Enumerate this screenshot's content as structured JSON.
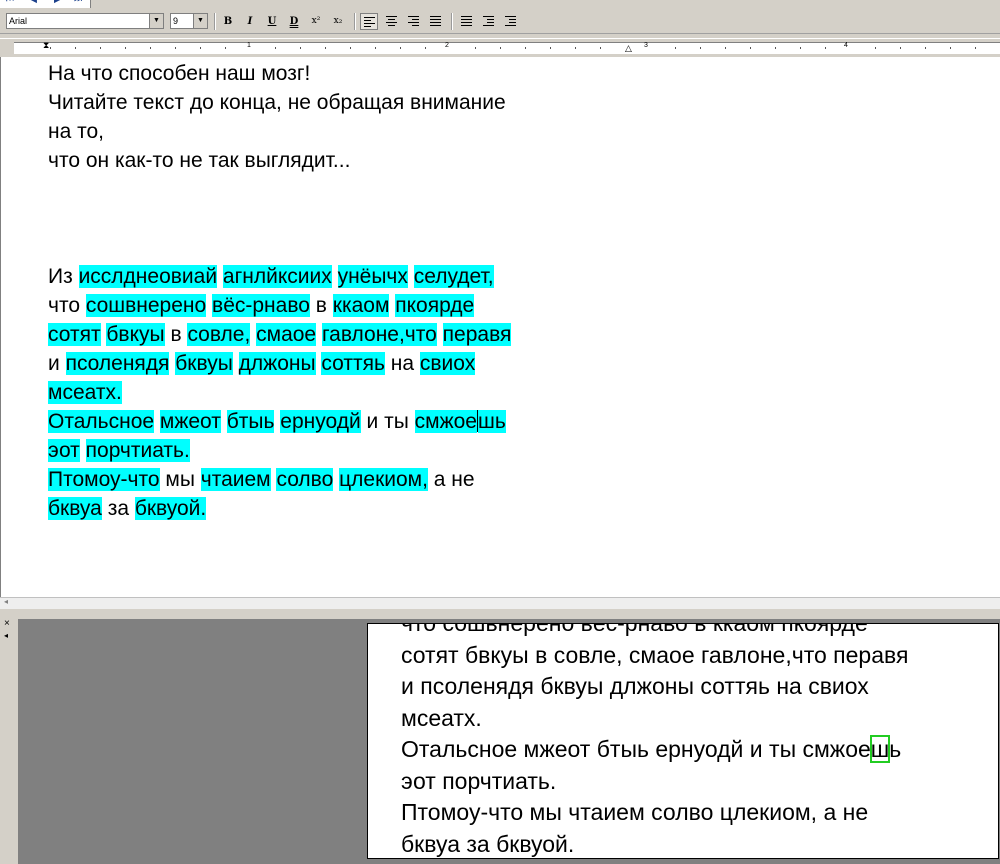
{
  "window": {
    "nav_buttons": [
      "⏮",
      "◀",
      "▶",
      "⏭"
    ]
  },
  "toolbar": {
    "font_name": "Arial",
    "font_size": "9",
    "bold": "B",
    "italic": "I",
    "underline": "U",
    "double_underline": "D",
    "superscript": "x²",
    "subscript": "x₂"
  },
  "ruler": {
    "numbers": [
      "1",
      "2",
      "3",
      "4"
    ]
  },
  "document": {
    "lines": [
      [
        {
          "t": "На что способен наш мозг!"
        }
      ],
      [
        {
          "t": "Читайте текст до конца, не обращая внимание"
        }
      ],
      [
        {
          "t": "на то,"
        }
      ],
      [
        {
          "t": "что он как-то не так выглядит..."
        }
      ],
      [
        {
          "t": ""
        }
      ],
      [
        {
          "t": ""
        }
      ],
      [
        {
          "t": ""
        }
      ],
      [
        {
          "t": "Из "
        },
        {
          "t": "исслднеовиай",
          "h": true
        },
        {
          "t": " "
        },
        {
          "t": "агнлйксиих",
          "h": true
        },
        {
          "t": " "
        },
        {
          "t": "унёычх",
          "h": true
        },
        {
          "t": " "
        },
        {
          "t": "селудет,",
          "h": true
        }
      ],
      [
        {
          "t": "что "
        },
        {
          "t": "сошвнерено",
          "h": true
        },
        {
          "t": " "
        },
        {
          "t": "вёс-рнаво",
          "h": true
        },
        {
          "t": " в "
        },
        {
          "t": "ккаом",
          "h": true
        },
        {
          "t": " "
        },
        {
          "t": "пкоярде",
          "h": true
        }
      ],
      [
        {
          "t": "сотят",
          "h": true
        },
        {
          "t": " "
        },
        {
          "t": "бвкуы",
          "h": true
        },
        {
          "t": " в "
        },
        {
          "t": "совле,",
          "h": true
        },
        {
          "t": " "
        },
        {
          "t": "смаое",
          "h": true
        },
        {
          "t": " "
        },
        {
          "t": "гавлоне,что",
          "h": true
        },
        {
          "t": " "
        },
        {
          "t": "перавя",
          "h": true
        }
      ],
      [
        {
          "t": "и "
        },
        {
          "t": "псоленядя",
          "h": true
        },
        {
          "t": " "
        },
        {
          "t": "бквуы",
          "h": true
        },
        {
          "t": " "
        },
        {
          "t": "длжоны",
          "h": true
        },
        {
          "t": " "
        },
        {
          "t": "соттяь",
          "h": true
        },
        {
          "t": " на "
        },
        {
          "t": "свиох",
          "h": true
        }
      ],
      [
        {
          "t": "мсеатх.",
          "h": true
        }
      ],
      [
        {
          "t": "Отальсное",
          "h": true
        },
        {
          "t": " "
        },
        {
          "t": "мжеот",
          "h": true
        },
        {
          "t": " "
        },
        {
          "t": "бтыь",
          "h": true
        },
        {
          "t": " "
        },
        {
          "t": "ернуодй",
          "h": true
        },
        {
          "t": " и ты "
        },
        {
          "t": "смжое",
          "h": true
        },
        {
          "caret": true
        },
        {
          "t": "шь",
          "h": true
        }
      ],
      [
        {
          "t": "эот",
          "h": true
        },
        {
          "t": " "
        },
        {
          "t": "порчтиать.",
          "h": true
        }
      ],
      [
        {
          "t": "Птомоу-что",
          "h": true
        },
        {
          "t": " мы "
        },
        {
          "t": "чтаием",
          "h": true
        },
        {
          "t": " "
        },
        {
          "t": "солво",
          "h": true
        },
        {
          "t": " "
        },
        {
          "t": "цлекиом,",
          "h": true
        },
        {
          "t": " а не"
        }
      ],
      [
        {
          "t": "бквуа",
          "h": true
        },
        {
          "t": " за "
        },
        {
          "t": "бквуой.",
          "h": true
        }
      ]
    ]
  },
  "preview": {
    "lines": [
      [
        {
          "t": "что сошвнерено вёс-рнаво в ккаом пкоярде"
        }
      ],
      [
        {
          "t": "сотят бвкуы в совле, смаое гавлоне,что перавя"
        }
      ],
      [
        {
          "t": "и псоленядя бквуы длжоны соттяь на свиох"
        }
      ],
      [
        {
          "t": "мсеатх."
        }
      ],
      [
        {
          "t": "Отальсное мжеот бтыь ернуодй и ты смжое"
        },
        {
          "t": "ш",
          "g": true
        },
        {
          "t": "ь"
        }
      ],
      [
        {
          "t": "эот порчтиать."
        }
      ],
      [
        {
          "t": "Птомоу-что мы чтаием солво цлекиом, а не"
        }
      ],
      [
        {
          "t": "бквуа за бквуой."
        }
      ]
    ]
  },
  "colors": {
    "highlight": "#00ffff",
    "match_box": "#22cc22"
  },
  "icons": {
    "close": "close-icon",
    "pin": "pin-icon"
  }
}
